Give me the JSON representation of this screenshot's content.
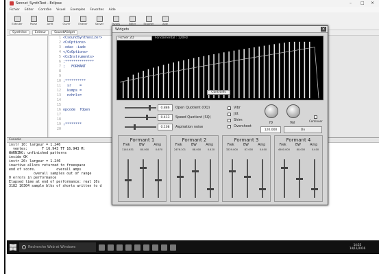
{
  "window": {
    "title": "Sonnet_SynthTest - Eclipse"
  },
  "menu": [
    "Fichier",
    "Editer",
    "Contrôle",
    "Visuel",
    "Exemples",
    "Favorites",
    "Aide"
  ],
  "toolbar": [
    "Exécuter",
    "Pause",
    "Arrêt",
    "Ouvrir",
    "Enlever",
    "Sauver",
    "Favoris",
    "Editer",
    "Exporter",
    "Aide"
  ],
  "tabs": [
    "Synthèse",
    "Editeur",
    "SoundWidget"
  ],
  "editor": {
    "line_numbers": [
      "1",
      "2",
      "3",
      "4",
      "5",
      "6",
      "7",
      "8",
      "9",
      "10",
      "11",
      "12",
      "13",
      "14",
      "15",
      "16",
      "17",
      "18",
      "19",
      "20"
    ],
    "lines": [
      "<CsoundSynthesizer>",
      "<CsOptions>",
      "-odac -iadc",
      "</CsOptions>",
      "<CsInstruments>",
      ";**************",
      ";   FORMANT",
      "",
      "",
      ";**********",
      "  sr    =",
      "  ksmps =",
      "  nchnls=",
      "",
      "",
      "opcode  fOpen",
      "",
      "",
      ";********",
      ""
    ]
  },
  "output": {
    "header": "Console",
    "lines": [
      "instr 10: largeur = 1.246",
      "  ventes:       T 16.943 TT 16.943 M:",
      "WARNING: unfinished patterns",
      "inside OK",
      "instr 20: largeur = 1.246",
      "inactive allocs returned to freespace",
      "end of score.          overall amps",
      "            overall samples out of range",
      "0 errors in performance",
      "Elapsed time at end of performance: real 10s",
      "3182 10304 sample blks of shorts written to d"
    ]
  },
  "taskbar": {
    "search": "Recherche Web et Windows",
    "time": "14:25",
    "date": "14/12/2016"
  },
  "widget": {
    "title": "Widgets",
    "spectrum_select": "Fichier 2D",
    "spectrum_label": "Fondamental : 120Hz",
    "pitch_tag": "Contrôlés",
    "sliders": [
      {
        "label": "Open Quotient (OQ)",
        "value": "0.886",
        "pos": 0.82
      },
      {
        "label": "Speed Quotient (SQ)",
        "value": "0.413",
        "pos": 0.72
      },
      {
        "label": "Aspiration noise",
        "value": "0.108",
        "pos": 0.3
      }
    ],
    "checks": [
      "Vibr",
      "Jitt",
      "Shim",
      "Overshoot"
    ],
    "knobs": {
      "f0_label": "f0",
      "vol_label": "Vol",
      "f0_value": "120.000",
      "vol_value": "On"
    },
    "smooth_label": "Continuer",
    "formants": [
      {
        "name": "Formant 1",
        "vals": [
          "1140.631",
          "80.000",
          "0.670"
        ],
        "levels": [
          0.55,
          0.2,
          0.55
        ]
      },
      {
        "name": "Formant 2",
        "vals": [
          "2476.101",
          "88.000",
          "0.420"
        ],
        "levels": [
          0.45,
          0.3,
          0.8
        ]
      },
      {
        "name": "Formant 3",
        "vals": [
          "3229.000",
          "87.000",
          "0.400"
        ],
        "levels": [
          0.3,
          0.45,
          0.8
        ]
      },
      {
        "name": "Formant 4",
        "vals": [
          "4500.000",
          "80.000",
          "0.400"
        ],
        "levels": [
          0.2,
          0.5,
          0.8
        ]
      }
    ],
    "col_headers": [
      "Frek",
      "BW",
      "Amp"
    ]
  },
  "colors": {
    "accent": "#1d3a8f",
    "dark": "#111111",
    "panel": "#d6d6d6"
  }
}
